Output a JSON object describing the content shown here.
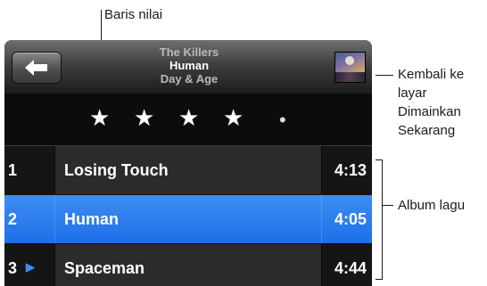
{
  "annotations": {
    "rating_label": "Baris nilai",
    "now_playing_label": [
      "Kembali ke",
      "layar",
      "Dimainkan",
      "Sekarang"
    ],
    "album_label": "Album lagu"
  },
  "header": {
    "artist": "The Killers",
    "song": "Human",
    "album": "Day & Age"
  },
  "rating": {
    "stars": 4,
    "max": 5
  },
  "tracks": [
    {
      "number": "1",
      "title": "Losing Touch",
      "duration": "4:13",
      "selected": false,
      "playing": false
    },
    {
      "number": "2",
      "title": "Human",
      "duration": "4:05",
      "selected": true,
      "playing": false
    },
    {
      "number": "3",
      "title": "Spaceman",
      "duration": "4:44",
      "selected": false,
      "playing": true
    }
  ],
  "icons": {
    "back": "back-arrow-icon",
    "album_art": "album-art-icon",
    "star": "star-icon",
    "playing": "play-indicator-icon"
  },
  "colors": {
    "selected_row": "#2a7ef0",
    "play_indicator": "#3b8cff"
  }
}
